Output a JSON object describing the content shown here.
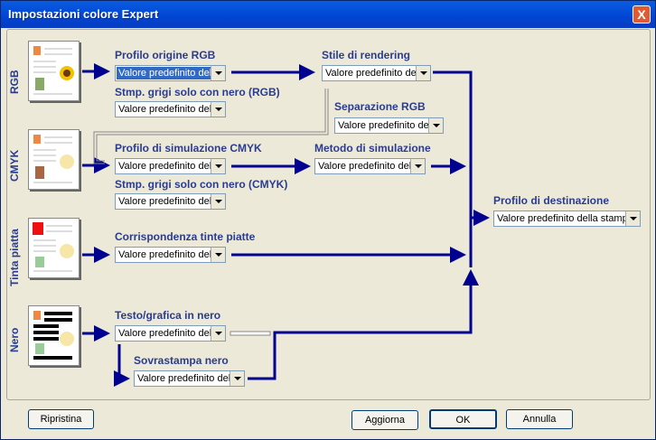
{
  "window": {
    "title": "Impostazioni colore Expert",
    "close_glyph": "X"
  },
  "rows": {
    "rgb": "RGB",
    "cmyk": "CMYK",
    "spot": "Tinta piatta",
    "black": "Nero"
  },
  "fields": {
    "rgb_source": {
      "label": "Profilo origine RGB",
      "value": "Valore predefinito dell"
    },
    "rgb_gray": {
      "label": "Stmp. grigi solo con nero (RGB)",
      "value": "Valore predefinito dell"
    },
    "rendering": {
      "label": "Stile di rendering",
      "value": "Valore predefinito del"
    },
    "rgb_sep": {
      "label": "Separazione RGB",
      "value": "Valore predefinito del"
    },
    "cmyk_sim": {
      "label": "Profilo di simulazione CMYK",
      "value": "Valore predefinito dell"
    },
    "sim_method": {
      "label": "Metodo di simulazione",
      "value": "Valore predefinito dell"
    },
    "cmyk_gray": {
      "label": "Stmp. grigi solo con nero (CMYK)",
      "value": "Valore predefinito dell"
    },
    "spot_match": {
      "label": "Corrispondenza tinte piatte",
      "value": "Valore predefinito dell"
    },
    "dest_profile": {
      "label": "Profilo di destinazione",
      "value": "Valore predefinito della stampan"
    },
    "black_text": {
      "label": "Testo/grafica in nero",
      "value": "Valore predefinito dell"
    },
    "overprint": {
      "label": "Sovrastampa nero",
      "value": "Valore predefinito dell"
    }
  },
  "buttons": {
    "reset": "Ripristina",
    "update": "Aggiorna",
    "ok": "OK",
    "cancel": "Annulla"
  },
  "colors": {
    "arrow": "#000090",
    "label": "#2a3c8f",
    "title_bar": "#0045d2"
  }
}
